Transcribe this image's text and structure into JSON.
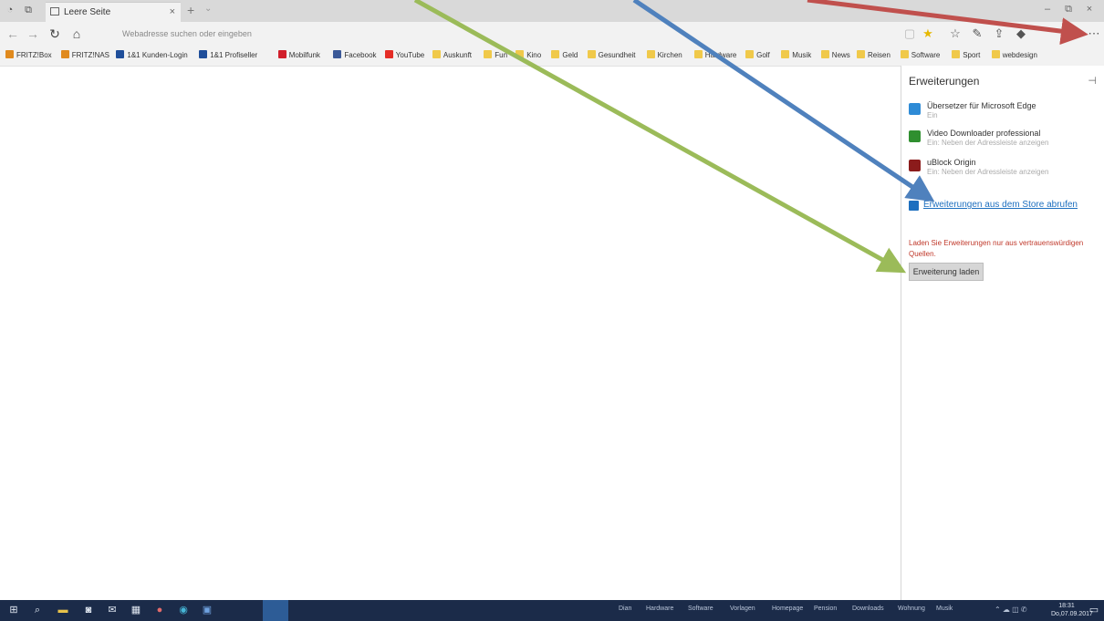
{
  "browser": {
    "tab_title": "Leere Seite",
    "close_tab": "×",
    "new_tab": "+",
    "tab_menu": "⌄",
    "address_placeholder": "Webadresse suchen oder eingeben",
    "window_controls": [
      "–",
      "⧉",
      "×"
    ]
  },
  "nav": {
    "back": "←",
    "forward": "→",
    "refresh": "↻",
    "home": "⌂",
    "more": "⋯"
  },
  "favorites": [
    {
      "label": "FRITZ!Box",
      "color": "#e08a1e"
    },
    {
      "label": "FRITZ!NAS",
      "color": "#e08a1e"
    },
    {
      "label": "1&1 Kunden-Login",
      "color": "#1f4e9a"
    },
    {
      "label": "1&1 Profiseller",
      "color": "#1f4e9a"
    },
    {
      "label": "Mobilfunk",
      "color": "#d11f2b"
    },
    {
      "label": "Facebook",
      "color": "#3b5998"
    },
    {
      "label": "YouTube",
      "color": "#e52d27"
    },
    {
      "label": "Auskunft",
      "color": "#f0c94a"
    },
    {
      "label": "Fun",
      "color": "#f0c94a"
    },
    {
      "label": "Kino",
      "color": "#f0c94a"
    },
    {
      "label": "Geld",
      "color": "#f0c94a"
    },
    {
      "label": "Gesundheit",
      "color": "#f0c94a"
    },
    {
      "label": "Kirchen",
      "color": "#f0c94a"
    },
    {
      "label": "Hardware",
      "color": "#f0c94a"
    },
    {
      "label": "Golf",
      "color": "#f0c94a"
    },
    {
      "label": "Musik",
      "color": "#f0c94a"
    },
    {
      "label": "News",
      "color": "#f0c94a"
    },
    {
      "label": "Reisen",
      "color": "#f0c94a"
    },
    {
      "label": "Software",
      "color": "#f0c94a"
    },
    {
      "label": "Sport",
      "color": "#f0c94a"
    },
    {
      "label": "webdesign",
      "color": "#f0c94a"
    }
  ],
  "panel": {
    "title": "Erweiterungen",
    "extensions": [
      {
        "name": "Übersetzer für Microsoft Edge",
        "sub": "Ein",
        "color": "#2e8bd6"
      },
      {
        "name": "Video Downloader professional",
        "sub": "Ein: Neben der Adressleiste anzeigen",
        "color": "#2f8f2f"
      },
      {
        "name": "uBlock Origin",
        "sub": "Ein: Neben der Adressleiste anzeigen",
        "color": "#8b1b1b"
      }
    ],
    "store_link": "Erweiterungen aus dem Store abrufen",
    "warning": "Laden Sie Erweiterungen nur aus vertrauenswürdigen Quellen.",
    "load_button": "Erweiterung laden"
  },
  "taskbar": {
    "tray_items": [
      "Dian",
      "Hardware",
      "Software",
      "Vorlagen",
      "Homepage",
      "Pension",
      "Downloads",
      "Wohnung",
      "Musik"
    ],
    "time": "18:31",
    "date": "Do,07.09.2017"
  },
  "annotations": {
    "arrow_colors": [
      "#c0504d",
      "#4f81bd",
      "#9bbb59"
    ]
  }
}
